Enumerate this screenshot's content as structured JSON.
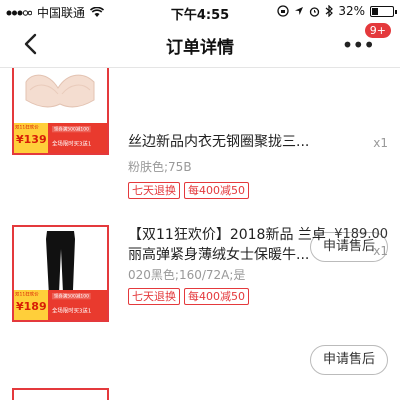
{
  "status_bar": {
    "carrier": "中国联通",
    "time": "下午4:55",
    "battery": "32%",
    "battery_level": 0.32
  },
  "nav": {
    "title": "订单详情",
    "more_icon": "more-dots-icon",
    "badge": "9+"
  },
  "items": [
    {
      "name": "丝边新品内衣无钢圈聚拢三...",
      "price": "",
      "quantity": "x1",
      "spec": "粉肤色;75B",
      "tags": [
        "七天退换",
        "每400减50"
      ],
      "promo": {
        "event": "双11狂欢价",
        "price": "¥139",
        "line1": "领券满500减100",
        "line2": "全场限时买3送1"
      },
      "after_sale": "申请售后"
    },
    {
      "name": "【双11狂欢价】2018新品 兰卓丽高弹紧身薄绒女士保暖牛...",
      "price": "¥189.00",
      "quantity": "x1",
      "spec": "020黑色;160/72A;是",
      "tags": [
        "七天退换",
        "每400减50"
      ],
      "promo": {
        "event": "双11狂欢价",
        "price": "¥189",
        "line1": "领券满500减100",
        "line2": "全场限时买3送1"
      },
      "after_sale": "申请售后"
    }
  ]
}
